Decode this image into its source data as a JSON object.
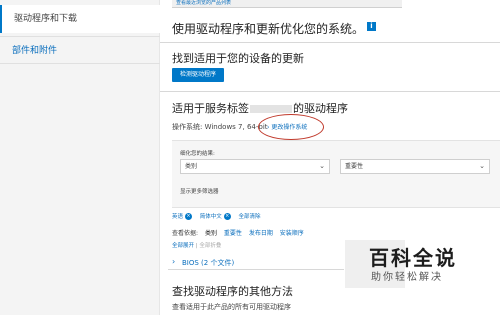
{
  "sidebar": {
    "items": [
      {
        "label": "驱动程序和下载",
        "active": true
      },
      {
        "label": "部件和附件",
        "active": false
      }
    ]
  },
  "topbar": {
    "link": "查看最近浏览的产品列表"
  },
  "header": {
    "title": "使用驱动程序和更新优化您的系统。",
    "badge": "i"
  },
  "detect": {
    "title": "找到适用于您的设备的更新",
    "button": "检测驱动程序"
  },
  "service_tag": {
    "title": "适用于服务标签",
    "title_suffix": "的驱动程序"
  },
  "os": {
    "label": "操作系统: Windows 7, 64-bit",
    "change_link": "更改操作系统"
  },
  "refine": {
    "label": "细化您的结果:",
    "category_select": "类别",
    "importance_select": "重要性",
    "more_filters": "显示更多筛选器"
  },
  "active_filters": {
    "english": "英语",
    "chinese": "简体中文",
    "clear_all": "全部清除"
  },
  "sort": {
    "label": "查看依据:",
    "options": [
      "类别",
      "重要性",
      "发布日期",
      "安装顺序"
    ],
    "expand": "全部展开",
    "collapse": "全部折叠"
  },
  "bios": {
    "label": "BIOS (2 个文件)",
    "toggle": "›"
  },
  "other": {
    "title": "查找驱动程序的其他方法",
    "desc": "查看适用于此产品的所有可用驱动程序"
  },
  "watermark": {
    "main": "百科全说",
    "sub": "助你轻松解决"
  },
  "colors": {
    "accent": "#0078c8",
    "annotation": "#c0392b"
  }
}
